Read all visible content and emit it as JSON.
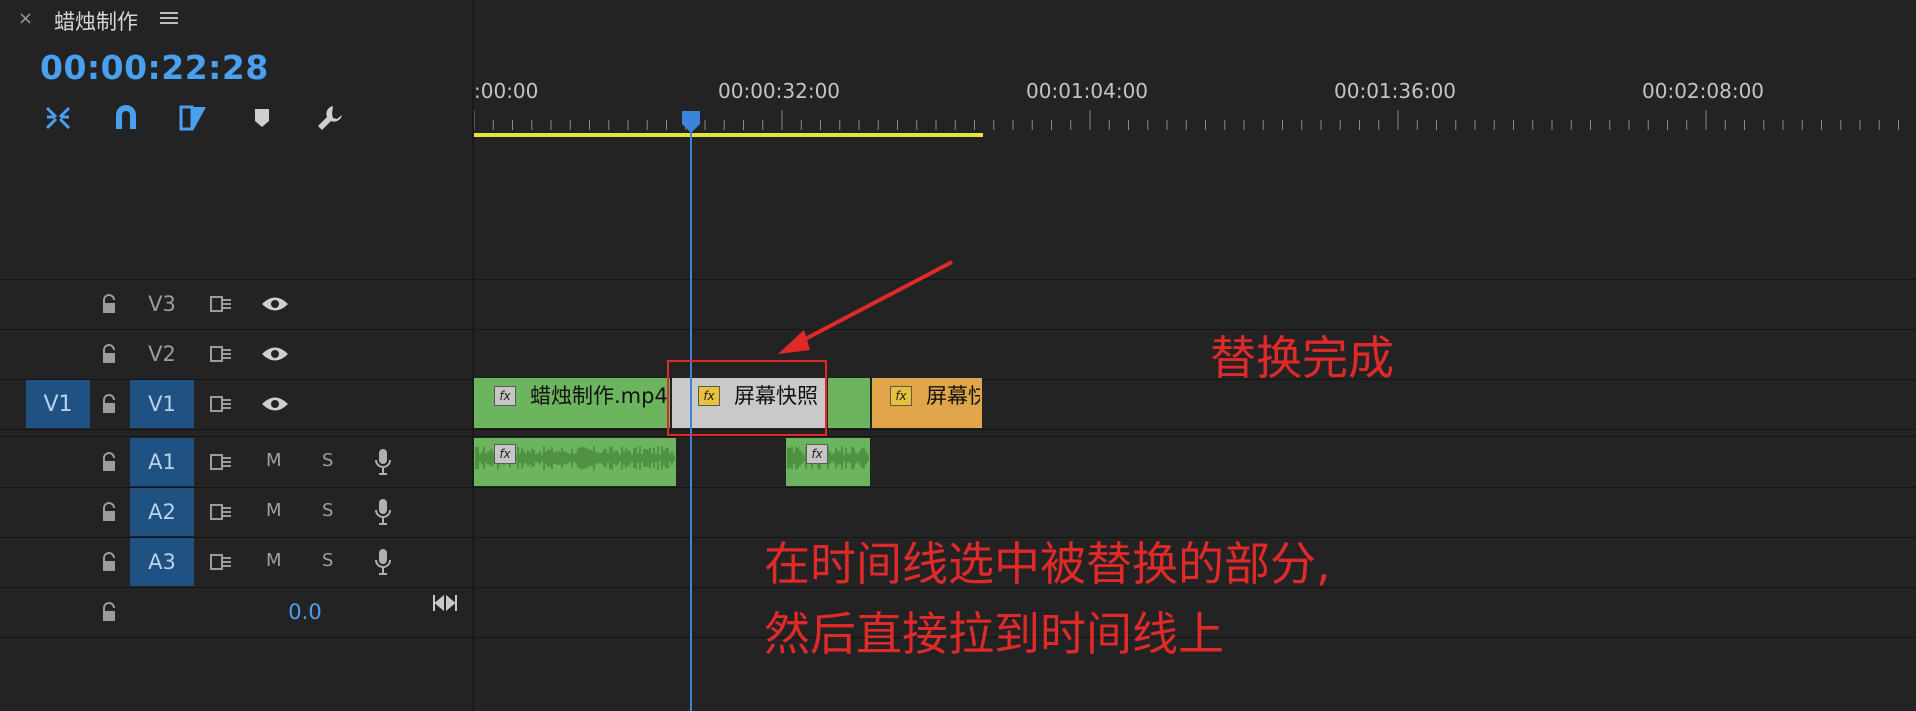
{
  "header": {
    "close_glyph": "×",
    "sequence_title": "蜡烛制作",
    "timecode": "00:00:22:28"
  },
  "tools": [
    "ripple-insert-icon",
    "snap-magnet-icon",
    "linked-selection-icon",
    "add-marker-icon",
    "wrench-settings-icon"
  ],
  "ruler": {
    "labels": [
      ":00:00",
      "00:00:32:00",
      "00:01:04:00",
      "00:01:36:00",
      "00:02:08:00"
    ]
  },
  "tracks": {
    "video": [
      {
        "name": "V3"
      },
      {
        "name": "V2"
      },
      {
        "name": "V1",
        "source_patch": "V1"
      }
    ],
    "audio": [
      {
        "name": "A1",
        "m": "M",
        "s": "S"
      },
      {
        "name": "A2",
        "m": "M",
        "s": "S"
      },
      {
        "name": "A3",
        "m": "M",
        "s": "S"
      }
    ],
    "master_volume": "0.0"
  },
  "clips": {
    "v1_clip1": {
      "label": "蜡烛制作.mp4",
      "fx": "fx"
    },
    "v1_clip2": {
      "label": "屏幕快照",
      "fx": "fx"
    },
    "v1_clip4": {
      "label": "屏幕快",
      "fx": "fx"
    },
    "a1_clip1": {
      "fx": "fx"
    },
    "a1_clip2": {
      "fx": "fx"
    }
  },
  "annotations": {
    "replace_done": "替换完成",
    "instruction_line1": "在时间线选中被替换的部分,",
    "instruction_line2": "然后直接拉到时间线上"
  },
  "colors": {
    "accent_blue": "#4aa0f0",
    "clip_green": "#6cb45d",
    "clip_orange": "#e1a54c",
    "annotation_red": "#e02a2a"
  }
}
